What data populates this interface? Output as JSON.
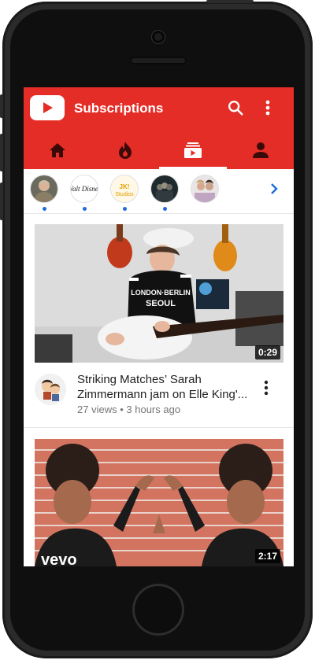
{
  "colors": {
    "brand": "#e52d27",
    "accent_dot": "#1e6cd8",
    "text_primary": "#212121",
    "text_secondary": "#757575"
  },
  "header": {
    "title": "Subscriptions",
    "logo_icon": "youtube-logo",
    "search_icon": "search-icon",
    "more_icon": "more-vert-icon"
  },
  "tabs": [
    {
      "name": "Home",
      "icon": "home-icon",
      "active": false
    },
    {
      "name": "Trending",
      "icon": "trending-flame-icon",
      "active": false
    },
    {
      "name": "Subscriptions",
      "icon": "subscriptions-icon",
      "active": true
    },
    {
      "name": "Account",
      "icon": "account-icon",
      "active": false
    }
  ],
  "channels": [
    {
      "name": "channel-1",
      "has_new": true
    },
    {
      "name": "Walt Disney Records",
      "logo_text": "Walt Disney",
      "has_new": true
    },
    {
      "name": "JK! Studios",
      "logo_text": "JK! Studios",
      "has_new": true
    },
    {
      "name": "channel-4",
      "has_new": true
    },
    {
      "name": "channel-5",
      "has_new": false
    }
  ],
  "videos": [
    {
      "title": "Striking Matches’ Sarah Zimmermann jam on Elle King'...",
      "views": "27 views",
      "age": "3 hours ago",
      "separator": "•",
      "duration": "0:29"
    },
    {
      "duration": "2:17",
      "watermark": "vevo"
    }
  ]
}
